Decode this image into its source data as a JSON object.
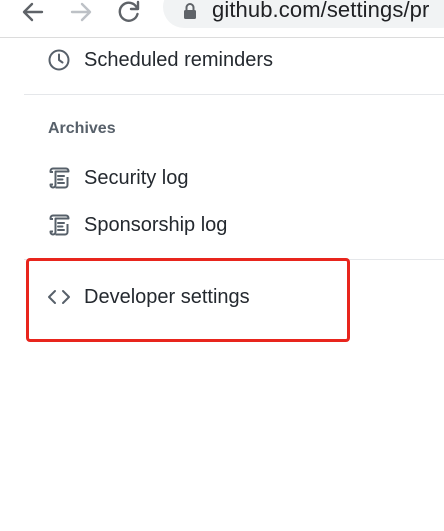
{
  "browser": {
    "url": "github.com/settings/pr"
  },
  "menu": {
    "scheduled_reminders": "Scheduled reminders",
    "archives_header": "Archives",
    "security_log": "Security log",
    "sponsorship_log": "Sponsorship log",
    "developer_settings": "Developer settings"
  },
  "colors": {
    "highlight": "#e8251d",
    "text": "#24292f",
    "muted": "#57606a"
  },
  "icons": {
    "scheduled_reminders": "clock-icon",
    "security_log": "log-icon",
    "sponsorship_log": "log-icon",
    "developer_settings": "code-icon"
  }
}
